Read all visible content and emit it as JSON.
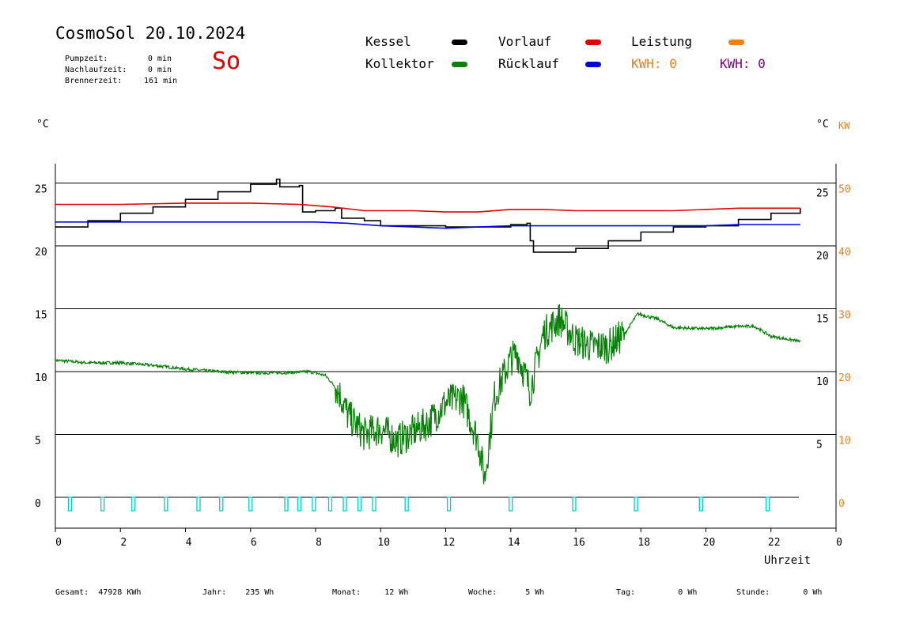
{
  "header": {
    "title": "CosmoSol 20.10.2024",
    "weekday": "So",
    "stats": [
      {
        "label": "Pumpzeit:",
        "value": "0 min"
      },
      {
        "label": "Nachlaufzeit:",
        "value": "0 min"
      },
      {
        "label": "Brennerzeit:",
        "value": "161 min"
      }
    ]
  },
  "legend": {
    "kessel": {
      "label": "Kessel",
      "color": "#000000"
    },
    "vorlauf": {
      "label": "Vorlauf",
      "color": "#e00000"
    },
    "leistung": {
      "label": "Leistung",
      "color": "#f08010"
    },
    "kollektor": {
      "label": "Kollektor",
      "color": "#0a800a"
    },
    "ruecklauf": {
      "label": "Rücklauf",
      "color": "#0000dd"
    },
    "kwh1": {
      "label": "KWH: 0",
      "color": "#f08010"
    },
    "kwh2": {
      "label": "KWH: 0",
      "color": "#800080"
    }
  },
  "axes": {
    "left_unit": "°C",
    "right_unit_c": "°C",
    "right_unit_kw": "KW",
    "xlabel": "Uhrzeit"
  },
  "footer": [
    {
      "label": "Gesamt:",
      "value": "47928 KWh"
    },
    {
      "label": "Jahr:",
      "value": "235 Wh"
    },
    {
      "label": "Monat:",
      "value": "12 Wh"
    },
    {
      "label": "Woche:",
      "value": "5 Wh"
    },
    {
      "label": "Tag:",
      "value": "0 Wh"
    },
    {
      "label": "Stunde:",
      "value": "0 Wh"
    }
  ],
  "chart_data": {
    "type": "line",
    "title": "CosmoSol 20.10.2024",
    "xlabel": "Uhrzeit",
    "ylabel": "°C",
    "xlim": [
      0,
      24
    ],
    "ylim": [
      -2,
      26.5
    ],
    "x_ticks": [
      0,
      2,
      4,
      6,
      8,
      10,
      12,
      14,
      16,
      18,
      20,
      22,
      0
    ],
    "y_left_ticks": [
      0,
      5,
      10,
      15,
      20,
      25
    ],
    "y_right_c_ticks": [
      "",
      "5",
      "10",
      "15",
      "20",
      "25"
    ],
    "y_right_kw_ticks": [
      "0",
      "10",
      "20",
      "30",
      "40",
      "50"
    ],
    "gridlines": [
      5,
      10,
      15,
      20,
      25
    ],
    "series": [
      {
        "name": "Kessel",
        "color": "#000000",
        "step": true,
        "points": [
          [
            0,
            21.5
          ],
          [
            1,
            22.0
          ],
          [
            2,
            22.6
          ],
          [
            3,
            23.1
          ],
          [
            4,
            23.7
          ],
          [
            5,
            24.3
          ],
          [
            6,
            24.9
          ],
          [
            6.8,
            25.3
          ],
          [
            6.9,
            24.7
          ],
          [
            7.5,
            24.8
          ],
          [
            7.6,
            22.7
          ],
          [
            8,
            22.8
          ],
          [
            8.6,
            23.0
          ],
          [
            8.8,
            22.2
          ],
          [
            9.5,
            22.0
          ],
          [
            10,
            21.6
          ],
          [
            11,
            21.6
          ],
          [
            12,
            21.5
          ],
          [
            13,
            21.5
          ],
          [
            14,
            21.7
          ],
          [
            14.5,
            21.8
          ],
          [
            14.6,
            20.4
          ],
          [
            14.7,
            19.5
          ],
          [
            16,
            19.8
          ],
          [
            17,
            20.4
          ],
          [
            18,
            21.1
          ],
          [
            19,
            21.5
          ],
          [
            20,
            21.6
          ],
          [
            21,
            22.1
          ],
          [
            22,
            22.6
          ],
          [
            22.9,
            23.0
          ]
        ]
      },
      {
        "name": "Vorlauf",
        "color": "#e00000",
        "points": [
          [
            0,
            23.3
          ],
          [
            2,
            23.3
          ],
          [
            4,
            23.4
          ],
          [
            6,
            23.4
          ],
          [
            7.5,
            23.3
          ],
          [
            8.5,
            23.1
          ],
          [
            9.5,
            22.8
          ],
          [
            11,
            22.8
          ],
          [
            12,
            22.7
          ],
          [
            13,
            22.7
          ],
          [
            14,
            22.9
          ],
          [
            15,
            22.9
          ],
          [
            16,
            22.8
          ],
          [
            17,
            22.8
          ],
          [
            18,
            22.8
          ],
          [
            19,
            22.8
          ],
          [
            20,
            22.9
          ],
          [
            21,
            23.0
          ],
          [
            22,
            23.0
          ],
          [
            22.9,
            23.0
          ]
        ]
      },
      {
        "name": "Rücklauf",
        "color": "#0000dd",
        "points": [
          [
            0,
            21.9
          ],
          [
            2,
            21.9
          ],
          [
            4,
            21.9
          ],
          [
            6,
            21.9
          ],
          [
            7,
            21.9
          ],
          [
            8,
            21.9
          ],
          [
            9,
            21.8
          ],
          [
            10,
            21.6
          ],
          [
            11,
            21.5
          ],
          [
            12,
            21.4
          ],
          [
            13,
            21.5
          ],
          [
            14,
            21.6
          ],
          [
            15,
            21.6
          ],
          [
            16,
            21.6
          ],
          [
            17,
            21.6
          ],
          [
            18,
            21.6
          ],
          [
            19,
            21.6
          ],
          [
            20,
            21.6
          ],
          [
            21,
            21.7
          ],
          [
            22,
            21.7
          ],
          [
            22.9,
            21.7
          ]
        ]
      },
      {
        "name": "Kollektor",
        "color": "#0a800a",
        "noisy": true,
        "points": [
          [
            0,
            10.9
          ],
          [
            1,
            10.7
          ],
          [
            2,
            10.7
          ],
          [
            3,
            10.5
          ],
          [
            4,
            10.2
          ],
          [
            5,
            10.0
          ],
          [
            6,
            9.9
          ],
          [
            7,
            9.9
          ],
          [
            7.8,
            10.0
          ],
          [
            8.3,
            9.7
          ],
          [
            8.7,
            8.5
          ],
          [
            9,
            6.5
          ],
          [
            9.5,
            5.0
          ],
          [
            10,
            5.5
          ],
          [
            10.5,
            4.5
          ],
          [
            11,
            5.2
          ],
          [
            11.5,
            6.0
          ],
          [
            12,
            7.5
          ],
          [
            12.5,
            8.0
          ],
          [
            13,
            4.5
          ],
          [
            13.2,
            1.5
          ],
          [
            13.5,
            8.0
          ],
          [
            14,
            11.0
          ],
          [
            14.2,
            11.5
          ],
          [
            14.6,
            8.5
          ],
          [
            15,
            13.0
          ],
          [
            15.5,
            14.2
          ],
          [
            16,
            12.5
          ],
          [
            16.5,
            12.0
          ],
          [
            17,
            12.0
          ],
          [
            17.5,
            13.0
          ],
          [
            17.9,
            14.6
          ],
          [
            18.5,
            14.2
          ],
          [
            19,
            13.5
          ],
          [
            20,
            13.4
          ],
          [
            21,
            13.6
          ],
          [
            21.5,
            13.6
          ],
          [
            22,
            12.8
          ],
          [
            22.9,
            12.4
          ]
        ]
      },
      {
        "name": "Pumpe",
        "color": "#00cccc",
        "pulses": true,
        "pulse_x": [
          0.45,
          1.45,
          2.4,
          3.4,
          4.4,
          5.1,
          6.0,
          7.1,
          7.5,
          7.95,
          8.45,
          8.9,
          9.35,
          9.8,
          10.8,
          12.1,
          14.0,
          15.95,
          17.85,
          19.85,
          21.9
        ]
      }
    ]
  }
}
